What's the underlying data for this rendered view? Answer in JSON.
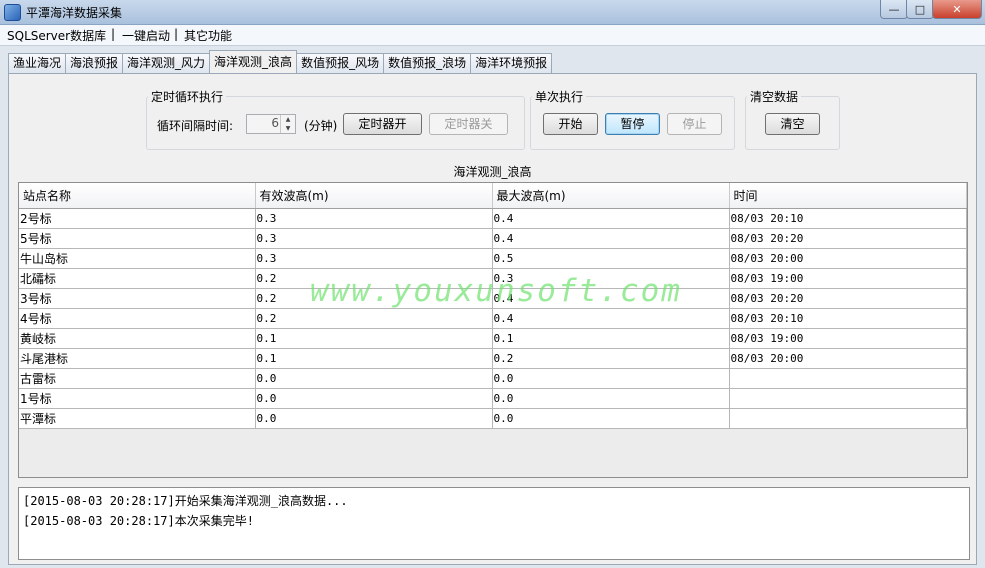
{
  "window": {
    "title": "平潭海洋数据采集",
    "min_glyph": "—",
    "max_glyph": "□",
    "close_glyph": "✕"
  },
  "menu": [
    "SQLServer数据库",
    "|",
    "一键启动",
    "|",
    "其它功能"
  ],
  "tabs": [
    "渔业海况",
    "海浪预报",
    "海洋观测_风力",
    "海洋观测_浪高",
    "数值预报_风场",
    "数值预报_浪场",
    "海洋环境预报"
  ],
  "active_tab": 3,
  "timer_group": {
    "label": "定时循环执行",
    "interval_label": "循环间隔时间:",
    "interval_value": "6",
    "unit": "(分钟)",
    "start_label": "定时器开",
    "stop_label": "定时器关"
  },
  "single_group": {
    "label": "单次执行",
    "start": "开始",
    "pause": "暂停",
    "stop": "停止"
  },
  "clear_group": {
    "label": "清空数据",
    "clear": "清空"
  },
  "table": {
    "title": "海洋观测_浪高",
    "columns": [
      "站点名称",
      "有效波高(m)",
      "最大波高(m)",
      "时间"
    ],
    "rows": [
      [
        "2号标",
        "0.3",
        "0.4",
        "08/03 20:10"
      ],
      [
        "5号标",
        "0.3",
        "0.4",
        "08/03 20:20"
      ],
      [
        "牛山岛标",
        "0.3",
        "0.5",
        "08/03 20:00"
      ],
      [
        "北礵标",
        "0.2",
        "0.3",
        "08/03 19:00"
      ],
      [
        "3号标",
        "0.2",
        "0.4",
        "08/03 20:20"
      ],
      [
        "4号标",
        "0.2",
        "0.4",
        "08/03 20:10"
      ],
      [
        "黄岐标",
        "0.1",
        "0.1",
        "08/03 19:00"
      ],
      [
        "斗尾港标",
        "0.1",
        "0.2",
        "08/03 20:00"
      ],
      [
        "古雷标",
        "0.0",
        "0.0",
        ""
      ],
      [
        "1号标",
        "0.0",
        "0.0",
        ""
      ],
      [
        "平潭标",
        "0.0",
        "0.0",
        ""
      ]
    ]
  },
  "log": [
    "[2015-08-03 20:28:17]开始采集海洋观测_浪高数据...",
    "[2015-08-03 20:28:17]本次采集完毕!"
  ],
  "watermark": "www.youxunsoft.com"
}
